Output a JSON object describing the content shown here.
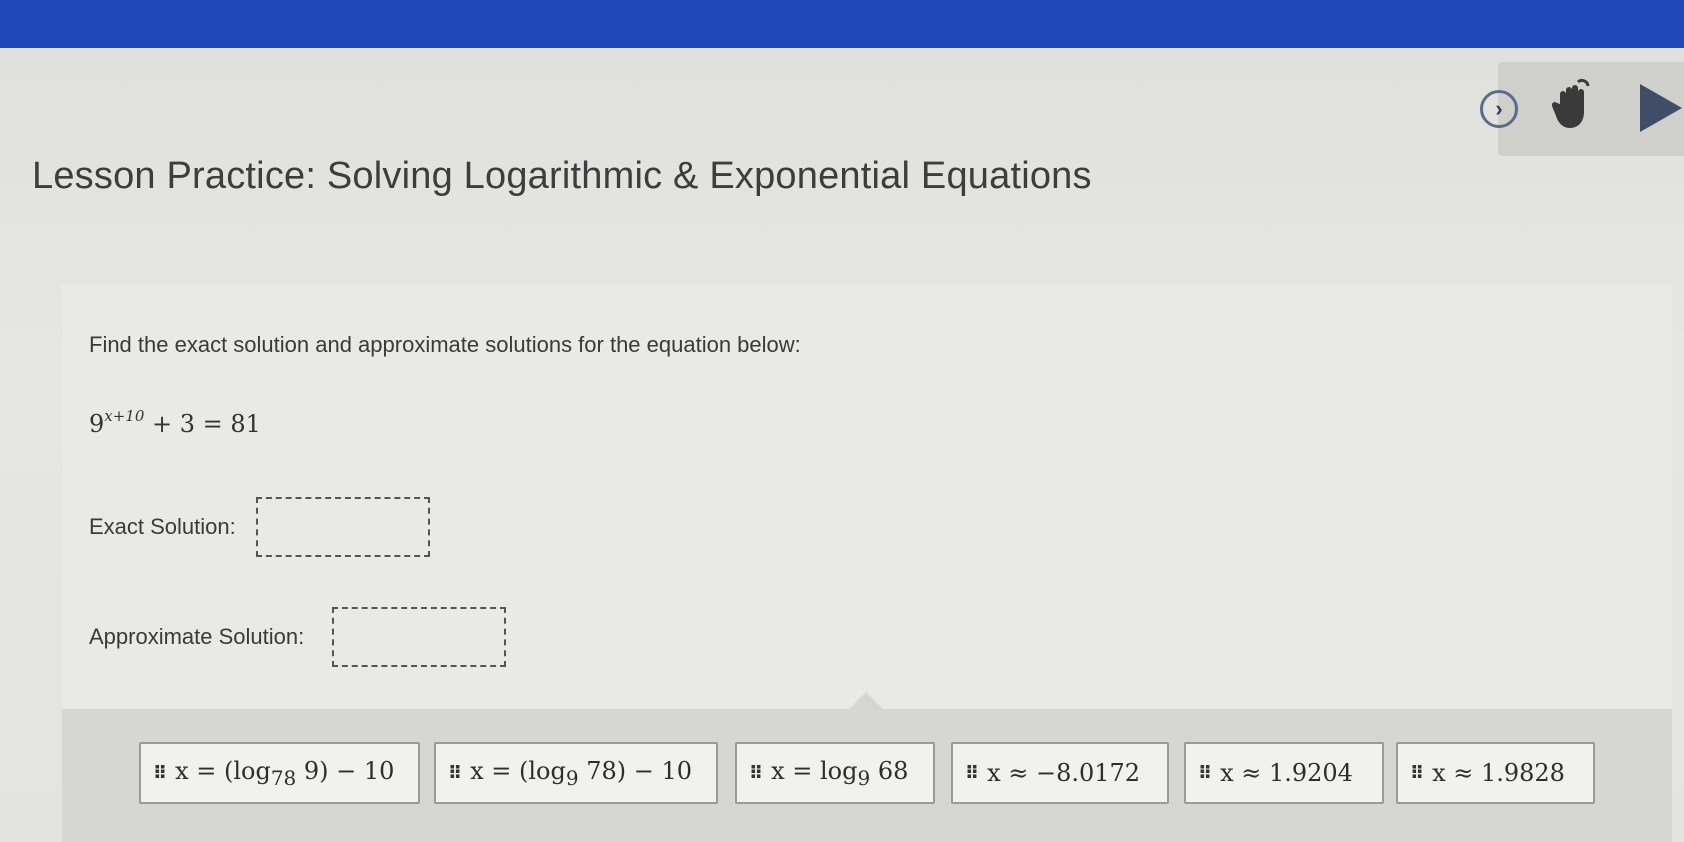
{
  "header": {
    "title": "Lesson Practice: Solving Logarithmic & Exponential Equations"
  },
  "toolbar": {
    "next_glyph": "›",
    "icons": [
      "chevron-right-icon",
      "raise-hand-icon",
      "play-icon"
    ]
  },
  "question": {
    "prompt": "Find the exact solution and approximate solutions for the equation below:",
    "equation": {
      "base": "9",
      "exponent": "x+10",
      "rest": " + 3 = 81"
    },
    "exact_label": "Exact Solution:",
    "approx_label": "Approximate Solution:",
    "exact_value": "",
    "approx_value": ""
  },
  "choices": {
    "grip": "⠿",
    "items": [
      {
        "pre": "x = (log",
        "sub": "78",
        "post": " 9) − 10"
      },
      {
        "pre": "x = (log",
        "sub": "9",
        "post": " 78) − 10"
      },
      {
        "pre": "x = log",
        "sub": "9",
        "post": " 68"
      },
      {
        "pre": "x ≈ −8.0172",
        "sub": "",
        "post": ""
      },
      {
        "pre": "x ≈ 1.9204",
        "sub": "",
        "post": ""
      },
      {
        "pre": "x ≈ 1.9828",
        "sub": "",
        "post": ""
      }
    ]
  },
  "colors": {
    "topbar": "#1f49b9",
    "background": "#e3e3df",
    "tray": "#d6d6d3"
  }
}
